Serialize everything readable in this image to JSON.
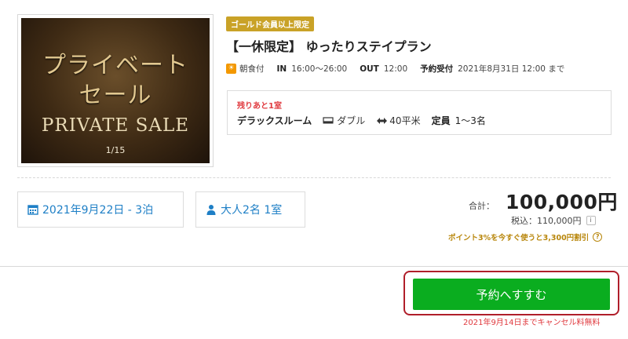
{
  "hero": {
    "title_line1": "プライベート",
    "title_line2": "セール",
    "title_en": "PRIVATE SALE",
    "counter": "1/15"
  },
  "plan": {
    "badge": "ゴールド会員以上限定",
    "title": "【一休限定】 ゆったりステイプラン",
    "meal_icon": "sun-icon",
    "meal": "朝食付",
    "checkin_label": "IN",
    "checkin": "16:00〜26:00",
    "checkout_label": "OUT",
    "checkout": "12:00",
    "reservation_label": "予約受付",
    "reservation": "2021年8月31日 12:00 まで"
  },
  "room": {
    "remaining": "残りあと1室",
    "name": "デラックスルーム",
    "bed": "ダブル",
    "area": "40平米",
    "capacity_label": "定員",
    "capacity": "1〜3名"
  },
  "search": {
    "date": "2021年9月22日 - 3泊",
    "guests": "大人2名 1室"
  },
  "price": {
    "total_label": "合計：",
    "total": "100,000円",
    "tax_label": "税込：110,000円",
    "points": "ポイント3%を今すぐ使うと3,300円割引"
  },
  "cta": {
    "label": "予約へすすむ",
    "cancel_note": "2021年9月14日までキャンセル料無料"
  },
  "colors": {
    "accent_green": "#0aad1f",
    "link_blue": "#1e7fc6",
    "gold": "#c9a227",
    "alert_red": "#e0393e"
  }
}
